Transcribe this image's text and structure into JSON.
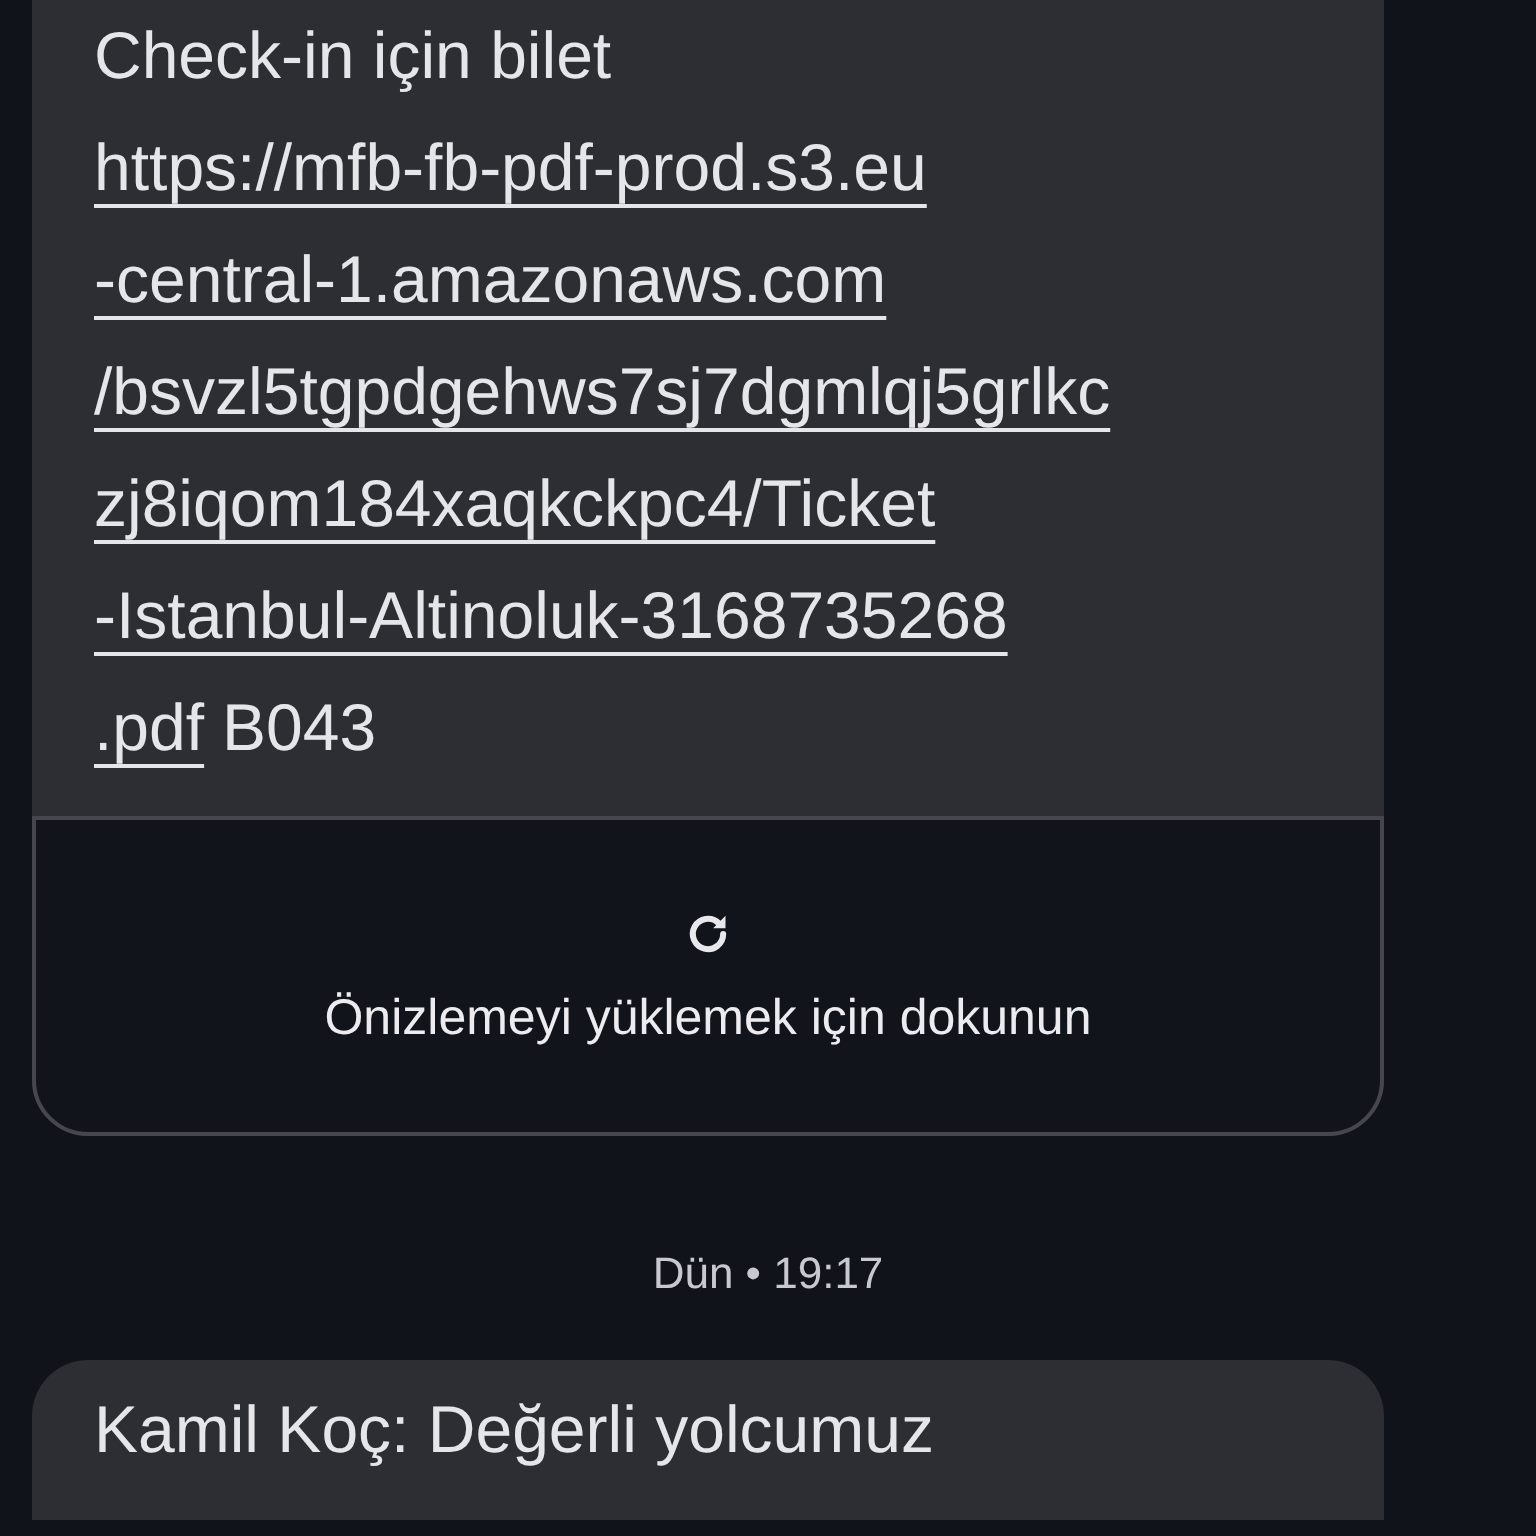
{
  "message": {
    "title": "Check-in için bilet",
    "link_lines": [
      "https://mfb-fb-pdf-prod.s3.eu",
      "-central-1.amazonaws.com",
      "/bsvzl5tgpdgehws7sj7dgmlqj5grlkc",
      "zj8iqom184xaqkckpc4/Ticket",
      "-Istanbul-Altinoluk-3168735268",
      ".pdf"
    ],
    "suffix": "B043",
    "preview": {
      "label": "Önizlemeyi yüklemek için dokunun"
    }
  },
  "timestamp": "Dün • 19:17",
  "next_message": {
    "text": "Kamil Koç: Değerli yolcumuz"
  }
}
